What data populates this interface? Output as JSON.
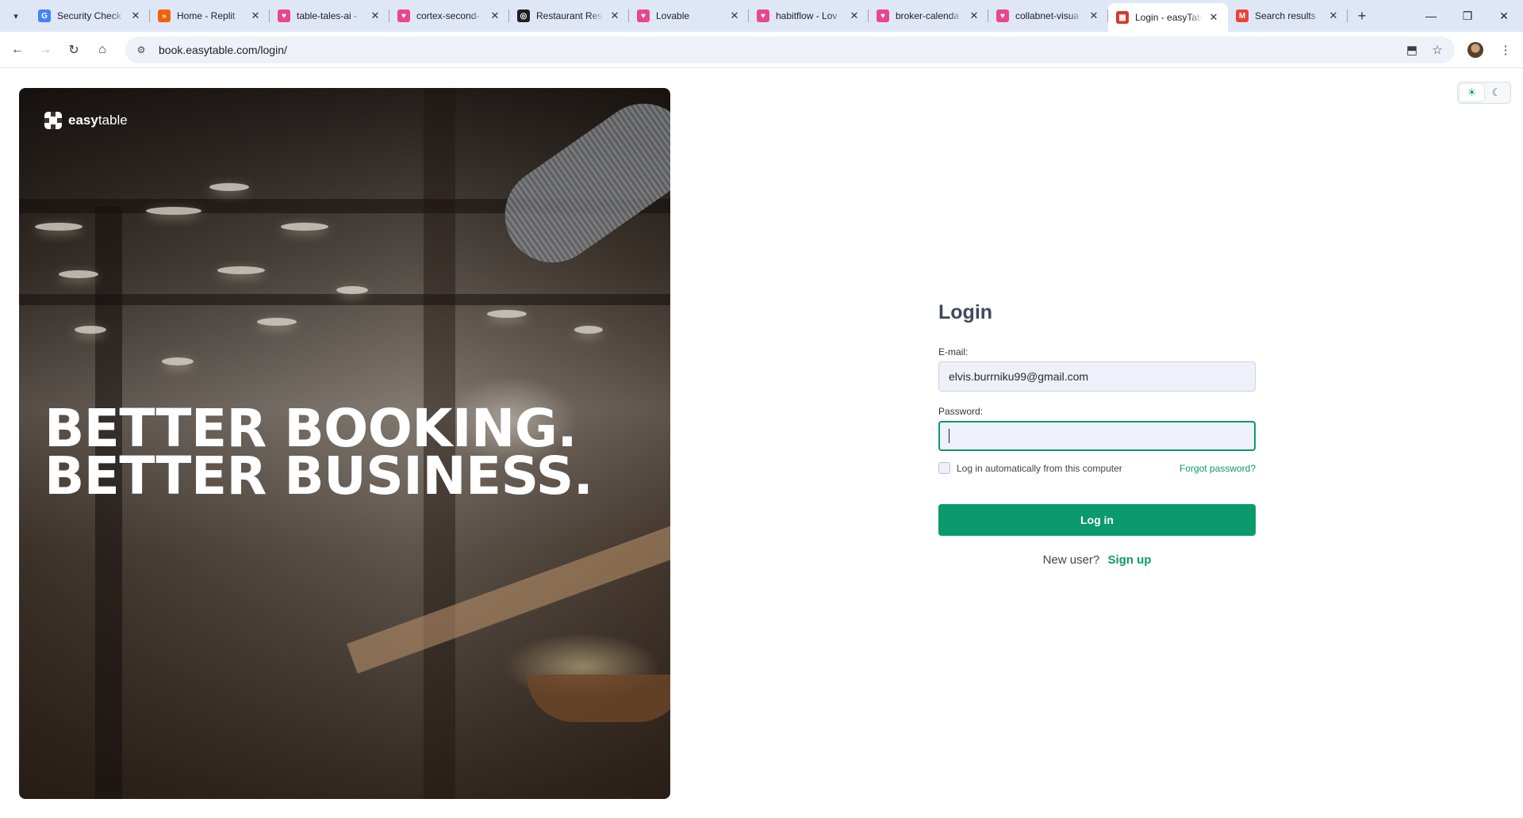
{
  "browser": {
    "tabs": [
      {
        "title": "Security Check",
        "icon": "google-icon",
        "color": "#4285f4",
        "glyph": "G"
      },
      {
        "title": "Home - Replit",
        "icon": "replit-icon",
        "color": "#f26207",
        "glyph": "»"
      },
      {
        "title": "table-tales-ai -",
        "icon": "lovable-icon",
        "color": "#e8478b",
        "glyph": "♥"
      },
      {
        "title": "cortex-second-",
        "icon": "lovable-icon",
        "color": "#e8478b",
        "glyph": "♥"
      },
      {
        "title": "Restaurant Res",
        "icon": "openai-icon",
        "color": "#202020",
        "glyph": "◎"
      },
      {
        "title": "Lovable",
        "icon": "lovable-icon",
        "color": "#e8478b",
        "glyph": "♥"
      },
      {
        "title": "habitflow - Lov",
        "icon": "lovable-icon",
        "color": "#e8478b",
        "glyph": "♥"
      },
      {
        "title": "broker-calenda",
        "icon": "lovable-icon",
        "color": "#e8478b",
        "glyph": "♥"
      },
      {
        "title": "collabnet-visua",
        "icon": "lovable-icon",
        "color": "#e8478b",
        "glyph": "♥"
      },
      {
        "title": "Login - easyTab",
        "icon": "easytable-icon",
        "color": "#d33a2c",
        "glyph": "▦",
        "active": true
      },
      {
        "title": "Search results",
        "icon": "gmail-icon",
        "color": "#ea4335",
        "glyph": "M"
      }
    ],
    "url": "book.easytable.com/login/"
  },
  "hero": {
    "logo_bold": "easy",
    "logo_light": "table",
    "headline_line1": "BETTER BOOKING.",
    "headline_line2": "BETTER BUSINESS."
  },
  "theme": {
    "light_icon": "sun-icon",
    "dark_icon": "moon-icon"
  },
  "form": {
    "title": "Login",
    "email_label": "E-mail:",
    "email_value": "elvis.burrniku99@gmail.com",
    "password_label": "Password:",
    "password_value": "",
    "remember_label": "Log in automatically from this computer",
    "forgot_label": "Forgot password?",
    "login_button": "Log in",
    "new_user_text": "New user?",
    "signup_link": "Sign up"
  },
  "colors": {
    "accent": "#0b9a6b",
    "title": "#3e4a5c"
  }
}
